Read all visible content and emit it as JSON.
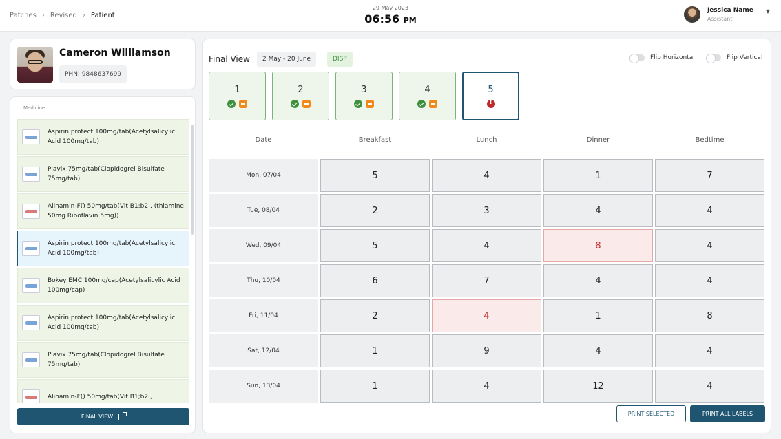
{
  "breadcrumb": [
    "Patches",
    "Revised",
    "Patient"
  ],
  "clock": {
    "date": "29 May 2023",
    "time": "06:56",
    "ampm": "PM"
  },
  "user": {
    "name": "Jessica Name",
    "role": "Assistant"
  },
  "patient": {
    "name": "Cameron Williamson",
    "phn": "PHN: 9848637699"
  },
  "medicine": {
    "title": "Medicine",
    "items": [
      {
        "label": "Aspirin protect 100mg/tab(Acetylsalicylic Acid 100mg/tab)",
        "icon": "blue",
        "selected": false
      },
      {
        "label": "Plavix 75mg/tab(Clopidogrel Bisulfate 75mg/tab)",
        "icon": "blue",
        "selected": false
      },
      {
        "label": "Alinamin-F() 50mg/tab(Vit B1;b2 , (thiamine 50mg Riboflavin 5mg))",
        "icon": "red",
        "selected": false
      },
      {
        "label": "Aspirin protect 100mg/tab(Acetylsalicylic Acid 100mg/tab)",
        "icon": "blue",
        "selected": true
      },
      {
        "label": "Bokey EMC 100mg/cap(Acetylsalicylic Acid 100mg/cap)",
        "icon": "blue",
        "selected": false
      },
      {
        "label": "Aspirin protect 100mg/tab(Acetylsalicylic Acid 100mg/tab)",
        "icon": "blue",
        "selected": false
      },
      {
        "label": "Plavix 75mg/tab(Clopidogrel Bisulfate 75mg/tab)",
        "icon": "blue",
        "selected": false
      },
      {
        "label": "Alinamin-F() 50mg/tab(Vit B1;b2 ,",
        "icon": "red",
        "selected": false
      }
    ],
    "final_view_label": "FINAL VIEW"
  },
  "main": {
    "title": "Final View",
    "range": "2 May - 20 June",
    "disp": "DISP",
    "flip_horizontal": "Flip Horizontal",
    "flip_vertical": "Flip Vertical",
    "batches": [
      {
        "label": "1",
        "status": "done"
      },
      {
        "label": "2",
        "status": "done"
      },
      {
        "label": "3",
        "status": "done"
      },
      {
        "label": "4",
        "status": "done"
      },
      {
        "label": "5",
        "status": "alert"
      }
    ],
    "columns": [
      "Date",
      "Breakfast",
      "Lunch",
      "Dinner",
      "Bedtime"
    ],
    "rows": [
      {
        "date": "Mon, 07/04",
        "values": [
          "5",
          "4",
          "1",
          "7"
        ],
        "flags": [
          false,
          false,
          false,
          false
        ]
      },
      {
        "date": "Tue, 08/04",
        "values": [
          "2",
          "3",
          "4",
          "4"
        ],
        "flags": [
          false,
          false,
          false,
          false
        ]
      },
      {
        "date": "Wed, 09/04",
        "values": [
          "5",
          "4",
          "8",
          "4"
        ],
        "flags": [
          false,
          false,
          true,
          false
        ]
      },
      {
        "date": "Thu, 10/04",
        "values": [
          "6",
          "7",
          "4",
          "4"
        ],
        "flags": [
          false,
          false,
          false,
          false
        ]
      },
      {
        "date": "Fri, 11/04",
        "values": [
          "2",
          "4",
          "1",
          "8"
        ],
        "flags": [
          false,
          true,
          false,
          false
        ]
      },
      {
        "date": "Sat, 12/04",
        "values": [
          "1",
          "9",
          "4",
          "4"
        ],
        "flags": [
          false,
          false,
          false,
          false
        ]
      },
      {
        "date": "Sun, 13/04",
        "values": [
          "1",
          "4",
          "12",
          "4"
        ],
        "flags": [
          false,
          false,
          false,
          false
        ]
      }
    ],
    "print_selected": "PRINT SELECTED",
    "print_all": "PRINT ALL LABELS"
  }
}
